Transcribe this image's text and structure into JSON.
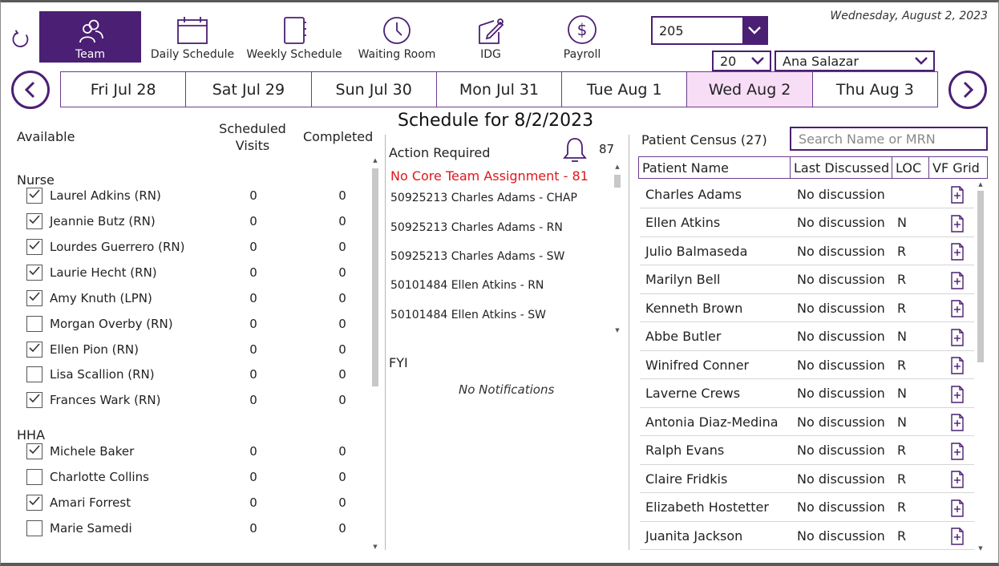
{
  "nav": {
    "items": [
      {
        "label": "Team",
        "icon": "team-icon"
      },
      {
        "label": "Daily Schedule",
        "icon": "calendar-icon"
      },
      {
        "label": "Weekly Schedule",
        "icon": "notebook-icon"
      },
      {
        "label": "Waiting Room",
        "icon": "clock-icon"
      },
      {
        "label": "IDG",
        "icon": "edit-icon"
      },
      {
        "label": "Payroll",
        "icon": "dollar-icon"
      }
    ]
  },
  "header": {
    "date": "Wednesday, August 2, 2023",
    "team_select": "205",
    "count_select": "20",
    "user_select": "Ana Salazar"
  },
  "days": [
    "Fri Jul 28",
    "Sat Jul 29",
    "Sun Jul 30",
    "Mon Jul 31",
    "Tue Aug 1",
    "Wed Aug 2",
    "Thu Aug 3"
  ],
  "schedule_title": "Schedule for 8/2/2023",
  "available": {
    "header": "Available",
    "scheduled_header_1": "Scheduled",
    "scheduled_header_2": "Visits",
    "completed_header": "Completed",
    "groups": [
      {
        "name": "Nurse",
        "staff": [
          {
            "name": "Laurel Adkins (RN)",
            "checked": true,
            "scheduled": "0",
            "completed": "0"
          },
          {
            "name": "Jeannie Butz (RN)",
            "checked": true,
            "scheduled": "0",
            "completed": "0"
          },
          {
            "name": "Lourdes Guerrero (RN)",
            "checked": true,
            "scheduled": "0",
            "completed": "0"
          },
          {
            "name": "Laurie Hecht (RN)",
            "checked": true,
            "scheduled": "0",
            "completed": "0"
          },
          {
            "name": "Amy Knuth (LPN)",
            "checked": true,
            "scheduled": "0",
            "completed": "0"
          },
          {
            "name": "Morgan Overby (RN)",
            "checked": false,
            "scheduled": "0",
            "completed": "0"
          },
          {
            "name": "Ellen Pion (RN)",
            "checked": true,
            "scheduled": "0",
            "completed": "0"
          },
          {
            "name": "Lisa Scallion (RN)",
            "checked": false,
            "scheduled": "0",
            "completed": "0"
          },
          {
            "name": "Frances Wark (RN)",
            "checked": true,
            "scheduled": "0",
            "completed": "0"
          }
        ]
      },
      {
        "name": "HHA",
        "staff": [
          {
            "name": "Michele Baker",
            "checked": true,
            "scheduled": "0",
            "completed": "0"
          },
          {
            "name": "Charlotte Collins",
            "checked": false,
            "scheduled": "0",
            "completed": "0"
          },
          {
            "name": "Amari Forrest",
            "checked": true,
            "scheduled": "0",
            "completed": "0"
          },
          {
            "name": "Marie Samedi",
            "checked": false,
            "scheduled": "0",
            "completed": "0"
          }
        ]
      }
    ]
  },
  "action_required": {
    "header": "Action Required",
    "bell_count": "87",
    "alert": "No Core Team Assignment - 81",
    "items": [
      "50925213 Charles Adams - CHAP",
      "50925213 Charles Adams - RN",
      "50925213 Charles Adams - SW",
      "50101484 Ellen Atkins - RN",
      "50101484 Ellen Atkins - SW"
    ]
  },
  "fyi": {
    "header": "FYI",
    "empty_text": "No Notifications"
  },
  "census": {
    "header": "Patient Census (27)",
    "search_placeholder": "Search Name or MRN",
    "columns": [
      "Patient Name",
      "Last Discussed",
      "LOC",
      "VF Grid"
    ],
    "patients": [
      {
        "name": "Charles Adams",
        "last": "No discussion",
        "loc": ""
      },
      {
        "name": "Ellen Atkins",
        "last": "No discussion",
        "loc": "N"
      },
      {
        "name": "Julio Balmaseda",
        "last": "No discussion",
        "loc": "R"
      },
      {
        "name": "Marilyn Bell",
        "last": "No discussion",
        "loc": "R"
      },
      {
        "name": "Kenneth Brown",
        "last": "No discussion",
        "loc": "R"
      },
      {
        "name": "Abbe Butler",
        "last": "No discussion",
        "loc": "N"
      },
      {
        "name": "Winifred Conner",
        "last": "No discussion",
        "loc": "R"
      },
      {
        "name": "Laverne Crews",
        "last": "No discussion",
        "loc": "N"
      },
      {
        "name": "Antonia Diaz-Medina",
        "last": "No discussion",
        "loc": "N"
      },
      {
        "name": "Ralph Evans",
        "last": "No discussion",
        "loc": "R"
      },
      {
        "name": "Claire Fridkis",
        "last": "No discussion",
        "loc": "R"
      },
      {
        "name": "Elizabeth Hostetter",
        "last": "No discussion",
        "loc": "R"
      },
      {
        "name": "Juanita Jackson",
        "last": "No discussion",
        "loc": "R"
      }
    ]
  },
  "colors": {
    "accent": "#4b1f73",
    "selected_day": "#f8ddf6",
    "alert": "#e0161b"
  }
}
